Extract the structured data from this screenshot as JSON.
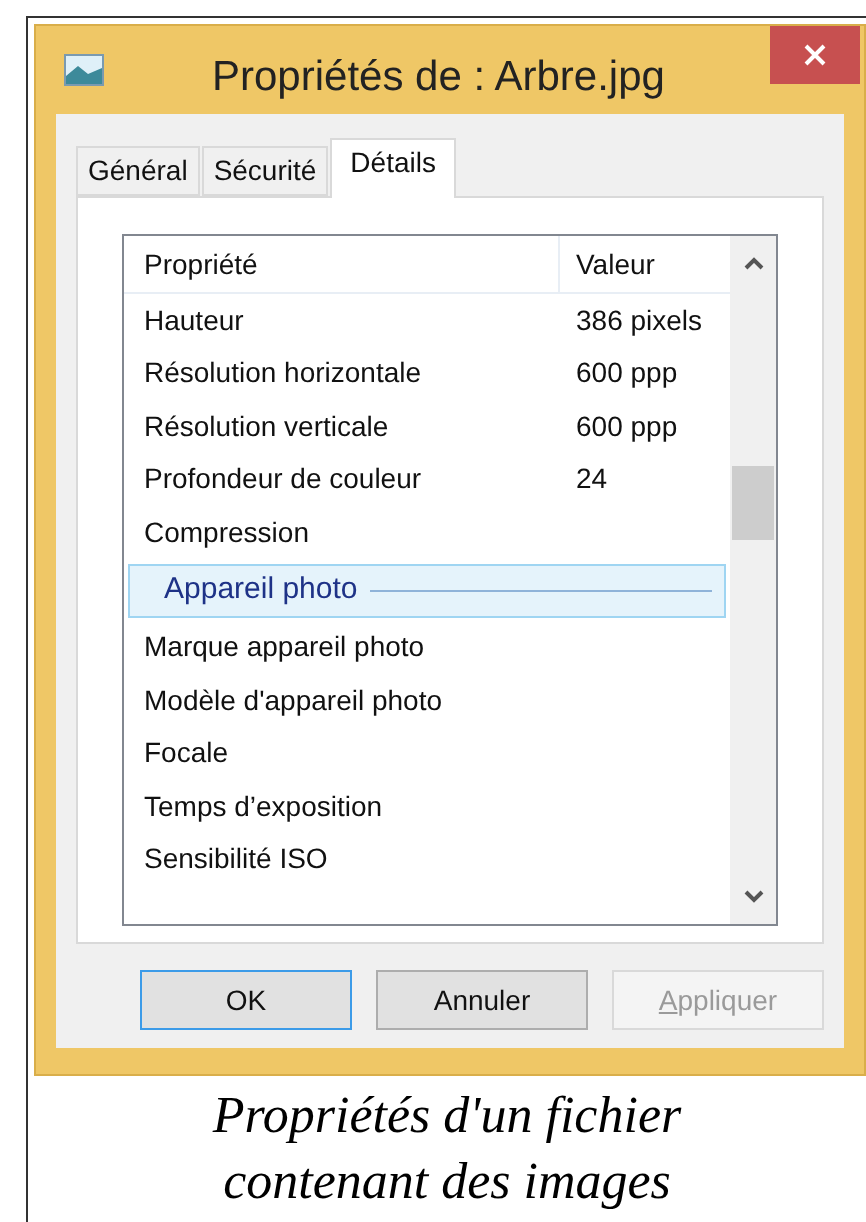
{
  "window": {
    "title": "Propriétés de : Arbre.jpg"
  },
  "tabs": [
    {
      "label": "Général",
      "selected": false
    },
    {
      "label": "Sécurité",
      "selected": false
    },
    {
      "label": "Détails",
      "selected": true
    }
  ],
  "list": {
    "columns": [
      "Propriété",
      "Valeur"
    ],
    "rows": [
      {
        "kind": "row",
        "name": "Hauteur",
        "value": "386 pixels",
        "selected": false
      },
      {
        "kind": "row",
        "name": "Résolution horizontale",
        "value": "600 ppp",
        "selected": false
      },
      {
        "kind": "row",
        "name": "Résolution verticale",
        "value": "600 ppp",
        "selected": false
      },
      {
        "kind": "row",
        "name": "Profondeur de couleur",
        "value": "24",
        "selected": false
      },
      {
        "kind": "row",
        "name": "Compression",
        "selected": false
      },
      {
        "kind": "group",
        "name": "Appareil photo",
        "selected": true
      },
      {
        "kind": "row",
        "name": "Marque appareil photo",
        "selected": false
      },
      {
        "kind": "row",
        "name": "Modèle d'appareil photo",
        "selected": false
      },
      {
        "kind": "row",
        "name": "Focale",
        "selected": false
      },
      {
        "kind": "row",
        "name": "Temps d’exposition",
        "selected": false
      },
      {
        "kind": "row",
        "name": "Sensibilité ISO",
        "selected": false
      }
    ]
  },
  "buttons": [
    {
      "label": "OK",
      "default": true,
      "disabled": false,
      "underline_first": false
    },
    {
      "label": "Annuler",
      "default": false,
      "disabled": false,
      "underline_first": false
    },
    {
      "label": "Appliquer",
      "default": false,
      "disabled": true,
      "underline_first": true
    }
  ],
  "caption": "Propriétés d'un fichier contenant des images"
}
